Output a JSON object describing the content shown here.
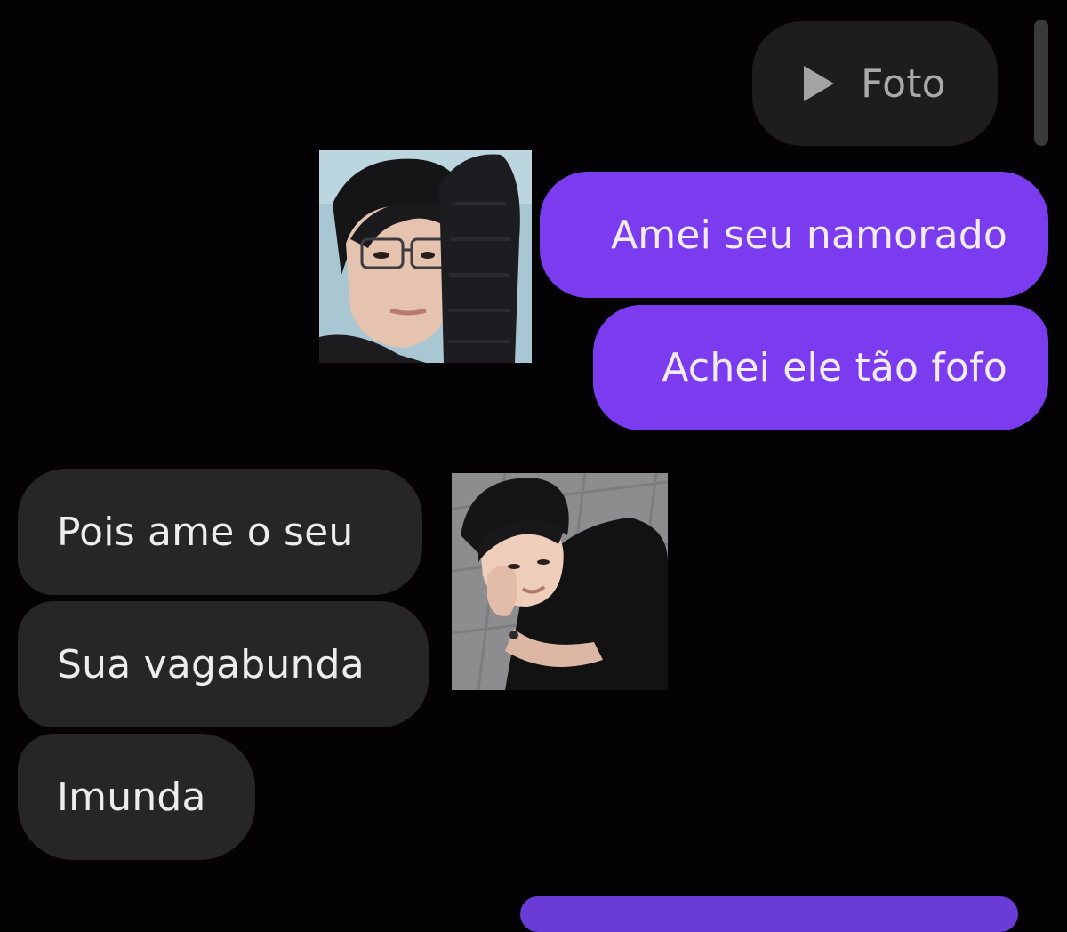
{
  "conversation": {
    "media_message": {
      "label": "Foto",
      "icon": "play-icon"
    },
    "sent_messages": [
      "Amei seu namorado",
      "Achei ele tão fofo"
    ],
    "received_messages": [
      "Pois ame o seu",
      "Sua vagabunda",
      "Imunda"
    ],
    "photos": [
      {
        "subject": "man with glasses and dark knit sleeve"
      },
      {
        "subject": "man in black t-shirt crouching, hand near face"
      }
    ]
  },
  "colors": {
    "background": "#040205",
    "sent_bubble": "#7b3cf0",
    "received_bubble": "#262528",
    "media_bubble": "#1d1c1f"
  }
}
